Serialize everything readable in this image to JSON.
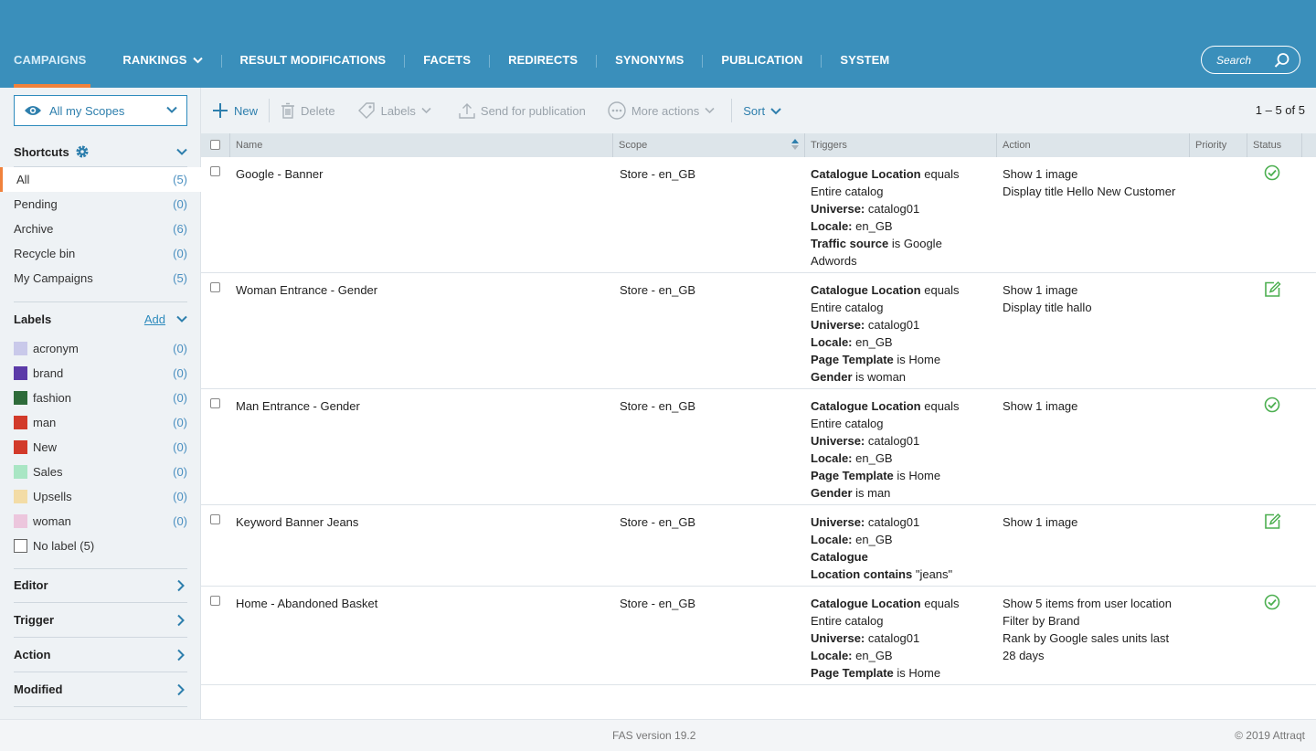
{
  "nav": {
    "items": [
      {
        "label": "CAMPAIGNS",
        "active": true
      },
      {
        "label": "RANKINGS",
        "dropdown": true
      },
      {
        "label": "RESULT MODIFICATIONS"
      },
      {
        "label": "FACETS"
      },
      {
        "label": "REDIRECTS"
      },
      {
        "label": "SYNONYMS"
      },
      {
        "label": "PUBLICATION"
      },
      {
        "label": "SYSTEM"
      }
    ],
    "search_placeholder": "Search"
  },
  "sidebar": {
    "scope_select": "All my Scopes",
    "shortcuts": {
      "title": "Shortcuts",
      "items": [
        {
          "label": "All",
          "count": "(5)",
          "selected": true
        },
        {
          "label": "Pending",
          "count": "(0)"
        },
        {
          "label": "Archive",
          "count": "(6)"
        },
        {
          "label": "Recycle bin",
          "count": "(0)"
        },
        {
          "label": "My Campaigns",
          "count": "(5)"
        }
      ]
    },
    "labels": {
      "title": "Labels",
      "add": "Add",
      "items": [
        {
          "label": "acronym",
          "count": "(0)",
          "color": "#c9c9ea"
        },
        {
          "label": "brand",
          "count": "(0)",
          "color": "#5b3aa8"
        },
        {
          "label": "fashion",
          "count": "(0)",
          "color": "#2e6b3a"
        },
        {
          "label": "man",
          "count": "(0)",
          "color": "#d23a2a"
        },
        {
          "label": "New",
          "count": "(0)",
          "color": "#d23a2a"
        },
        {
          "label": "Sales",
          "count": "(0)",
          "color": "#a9e6c4"
        },
        {
          "label": "Upsells",
          "count": "(0)",
          "color": "#f3dca6"
        },
        {
          "label": "woman",
          "count": "(0)",
          "color": "#ecc6dd"
        }
      ],
      "no_label": "No label (5)"
    },
    "filters": [
      "Editor",
      "Trigger",
      "Action",
      "Modified"
    ]
  },
  "toolbar": {
    "new": "New",
    "delete": "Delete",
    "labels": "Labels",
    "send": "Send for publication",
    "more": "More actions",
    "sort": "Sort",
    "pager": "1 – 5 of 5"
  },
  "table": {
    "columns": [
      "Name",
      "Scope",
      "Triggers",
      "Action",
      "Priority",
      "Status"
    ],
    "rows": [
      {
        "name": "Google - Banner",
        "scope": "Store - en_GB",
        "triggers": [
          {
            "b": "Catalogue Location",
            "t": " equals"
          },
          {
            "b": "",
            "t": "Entire catalog"
          },
          {
            "b": "Universe:",
            "t": " catalog01"
          },
          {
            "b": "Locale:",
            "t": " en_GB"
          },
          {
            "b": "Traffic source",
            "t": " is Google"
          },
          {
            "b": "",
            "t": "Adwords"
          }
        ],
        "actions": [
          "Show 1 image",
          "Display title Hello New Customer"
        ],
        "status": "published-icon"
      },
      {
        "name": "Woman Entrance - Gender",
        "scope": "Store - en_GB",
        "triggers": [
          {
            "b": "Catalogue Location",
            "t": " equals"
          },
          {
            "b": "",
            "t": "Entire catalog"
          },
          {
            "b": "Universe:",
            "t": " catalog01"
          },
          {
            "b": "Locale:",
            "t": " en_GB"
          },
          {
            "b": "Page Template",
            "t": " is Home"
          },
          {
            "b": "Gender",
            "t": " is woman"
          }
        ],
        "actions": [
          "Show 1 image",
          "Display title hallo"
        ],
        "status": "edited-icon"
      },
      {
        "name": "Man Entrance - Gender",
        "scope": "Store - en_GB",
        "triggers": [
          {
            "b": "Catalogue Location",
            "t": " equals"
          },
          {
            "b": "",
            "t": "Entire catalog"
          },
          {
            "b": "Universe:",
            "t": " catalog01"
          },
          {
            "b": "Locale:",
            "t": " en_GB"
          },
          {
            "b": "Page Template",
            "t": " is Home"
          },
          {
            "b": "Gender",
            "t": " is man"
          }
        ],
        "actions": [
          "Show 1 image"
        ],
        "status": "published-icon"
      },
      {
        "name": "Keyword Banner Jeans",
        "scope": "Store - en_GB",
        "triggers": [
          {
            "b": "Universe:",
            "t": " catalog01"
          },
          {
            "b": "Locale:",
            "t": " en_GB"
          },
          {
            "b": "Catalogue",
            "t": ""
          },
          {
            "b": "Location contains",
            "t": " \"jeans\""
          }
        ],
        "actions": [
          "Show 1 image"
        ],
        "status": "edited-icon"
      },
      {
        "name": "Home - Abandoned Basket",
        "scope": "Store - en_GB",
        "triggers": [
          {
            "b": "Catalogue Location",
            "t": " equals"
          },
          {
            "b": "",
            "t": "Entire catalog"
          },
          {
            "b": "Universe:",
            "t": " catalog01"
          },
          {
            "b": "Locale:",
            "t": " en_GB"
          },
          {
            "b": "Page Template",
            "t": " is Home"
          }
        ],
        "actions": [
          "Show 5 items from user location",
          "Filter by Brand",
          "Rank by Google sales units last",
          "28 days"
        ],
        "status": "published-icon"
      }
    ]
  },
  "footer": {
    "version": "FAS version 19.2",
    "copyright": "© 2019 Attraqt"
  },
  "colors": {
    "header": "#3a8fbb",
    "accent": "#f0823c",
    "link": "#2e7fad",
    "status_green": "#4caf50"
  }
}
